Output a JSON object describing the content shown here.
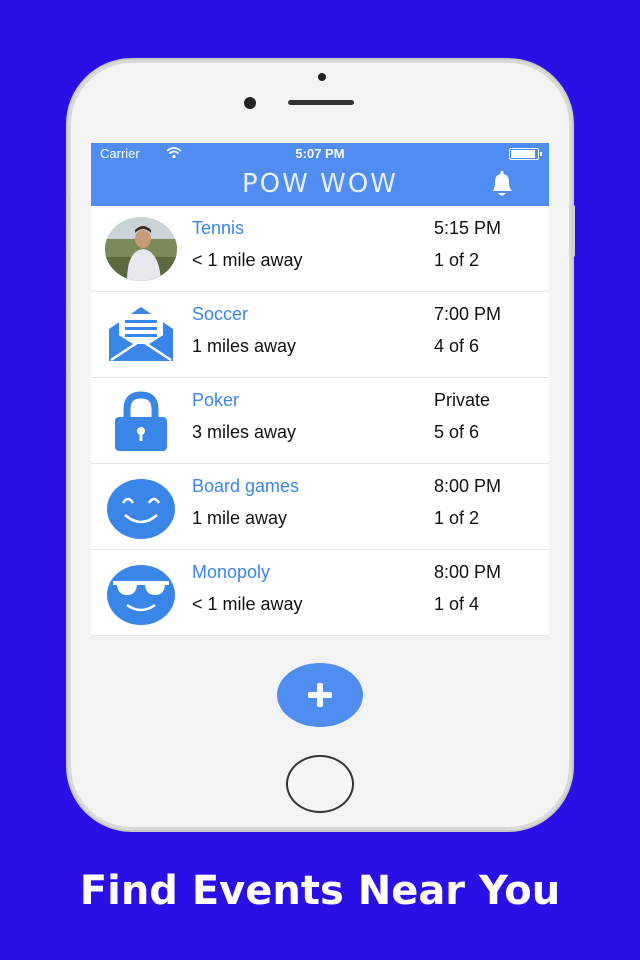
{
  "status_bar": {
    "carrier": "Carrier",
    "time": "5:07 PM"
  },
  "header": {
    "title": "POW WOW",
    "notification_icon": "bell-icon"
  },
  "events": [
    {
      "icon": "user-photo",
      "name": "Tennis",
      "distance": "< 1 mile away",
      "time": "5:15 PM",
      "count": "1 of 2"
    },
    {
      "icon": "envelope-icon",
      "name": "Soccer",
      "distance": "1 miles away",
      "time": "7:00 PM",
      "count": "4 of 6"
    },
    {
      "icon": "lock-icon",
      "name": "Poker",
      "distance": "3 miles away",
      "time": "Private",
      "count": "5 of 6"
    },
    {
      "icon": "smiley-icon",
      "name": "Board games",
      "distance": "1 mile away",
      "time": "8:00 PM",
      "count": "1 of 2"
    },
    {
      "icon": "sunglasses-smiley-icon",
      "name": "Monopoly",
      "distance": "< 1 mile away",
      "time": "8:00 PM",
      "count": "1 of 4"
    }
  ],
  "add_button": {
    "icon": "plus-icon"
  },
  "caption": "Find Events Near You",
  "colors": {
    "background": "#2a10e6",
    "accent": "#4f8df0",
    "event_name": "#3a86e8"
  }
}
